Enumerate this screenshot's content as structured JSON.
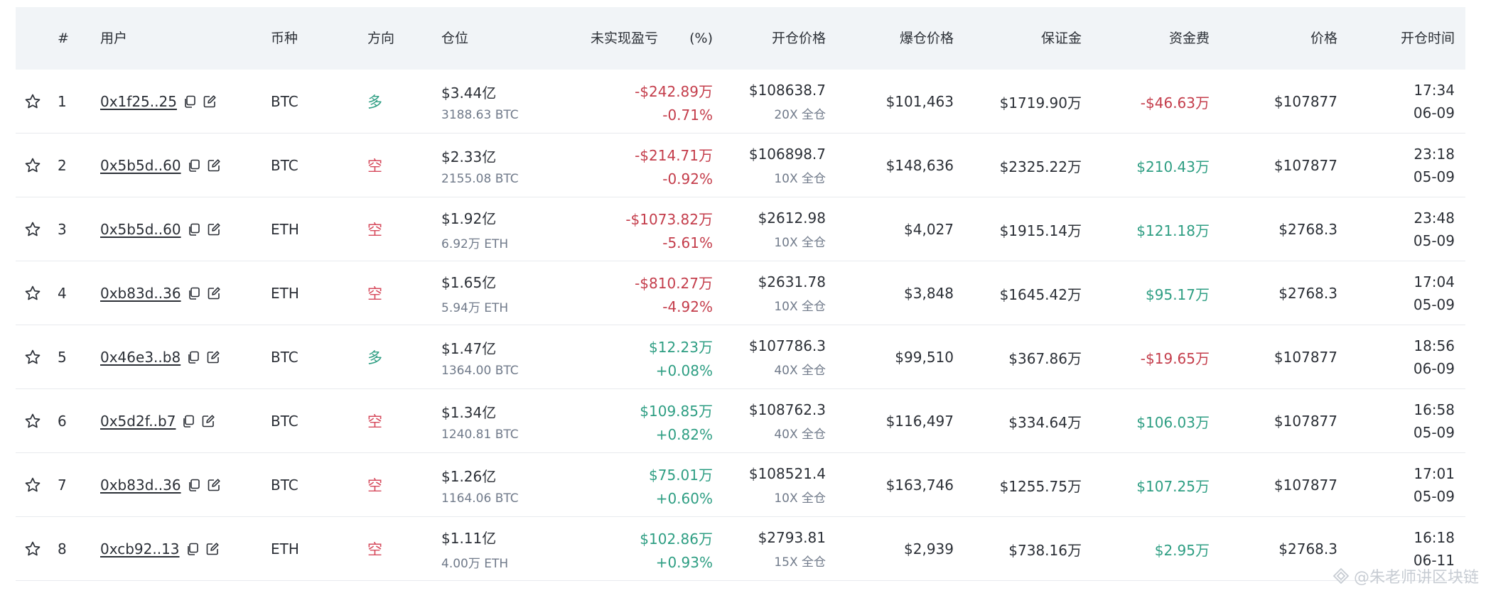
{
  "headers": {
    "idx": "#",
    "user": "用户",
    "coin": "币种",
    "direction": "方向",
    "position": "仓位",
    "pnl": "未实现盈亏",
    "pnl_pct": "(%)",
    "entry": "开仓价格",
    "liq": "爆仓价格",
    "margin": "保证金",
    "funding": "资金费",
    "price": "价格",
    "open_time": "开仓时间"
  },
  "rows": [
    {
      "idx": "1",
      "user": "0x1f25..25",
      "coin": "BTC",
      "direction": "多",
      "dir_type": "long",
      "pos_value": "$3.44亿",
      "pos_size": "3188.63 BTC",
      "pnl": "-$242.89万",
      "pnl_pct": "-0.71%",
      "pnl_sign": "neg",
      "entry": "$108638.7",
      "leverage": "20X 全仓",
      "liq": "$101,463",
      "margin": "$1719.90万",
      "funding": "-$46.63万",
      "fund_sign": "neg",
      "price": "$107877",
      "time": "17:34",
      "date": "06-09"
    },
    {
      "idx": "2",
      "user": "0x5b5d..60",
      "coin": "BTC",
      "direction": "空",
      "dir_type": "short",
      "pos_value": "$2.33亿",
      "pos_size": "2155.08 BTC",
      "pnl": "-$214.71万",
      "pnl_pct": "-0.92%",
      "pnl_sign": "neg",
      "entry": "$106898.7",
      "leverage": "10X 全仓",
      "liq": "$148,636",
      "margin": "$2325.22万",
      "funding": "$210.43万",
      "fund_sign": "pos",
      "price": "$107877",
      "time": "23:18",
      "date": "05-09"
    },
    {
      "idx": "3",
      "user": "0x5b5d..60",
      "coin": "ETH",
      "direction": "空",
      "dir_type": "short",
      "pos_value": "$1.92亿",
      "pos_size": "6.92万 ETH",
      "pnl": "-$1073.82万",
      "pnl_pct": "-5.61%",
      "pnl_sign": "neg",
      "entry": "$2612.98",
      "leverage": "10X 全仓",
      "liq": "$4,027",
      "margin": "$1915.14万",
      "funding": "$121.18万",
      "fund_sign": "pos",
      "price": "$2768.3",
      "time": "23:48",
      "date": "05-09"
    },
    {
      "idx": "4",
      "user": "0xb83d..36",
      "coin": "ETH",
      "direction": "空",
      "dir_type": "short",
      "pos_value": "$1.65亿",
      "pos_size": "5.94万 ETH",
      "pnl": "-$810.27万",
      "pnl_pct": "-4.92%",
      "pnl_sign": "neg",
      "entry": "$2631.78",
      "leverage": "10X 全仓",
      "liq": "$3,848",
      "margin": "$1645.42万",
      "funding": "$95.17万",
      "fund_sign": "pos",
      "price": "$2768.3",
      "time": "17:04",
      "date": "05-09"
    },
    {
      "idx": "5",
      "user": "0x46e3..b8",
      "coin": "BTC",
      "direction": "多",
      "dir_type": "long",
      "pos_value": "$1.47亿",
      "pos_size": "1364.00 BTC",
      "pnl": "$12.23万",
      "pnl_pct": "+0.08%",
      "pnl_sign": "pos",
      "entry": "$107786.3",
      "leverage": "40X 全仓",
      "liq": "$99,510",
      "margin": "$367.86万",
      "funding": "-$19.65万",
      "fund_sign": "neg",
      "price": "$107877",
      "time": "18:56",
      "date": "06-09"
    },
    {
      "idx": "6",
      "user": "0x5d2f..b7",
      "coin": "BTC",
      "direction": "空",
      "dir_type": "short",
      "pos_value": "$1.34亿",
      "pos_size": "1240.81 BTC",
      "pnl": "$109.85万",
      "pnl_pct": "+0.82%",
      "pnl_sign": "pos",
      "entry": "$108762.3",
      "leverage": "40X 全仓",
      "liq": "$116,497",
      "margin": "$334.64万",
      "funding": "$106.03万",
      "fund_sign": "pos",
      "price": "$107877",
      "time": "16:58",
      "date": "05-09"
    },
    {
      "idx": "7",
      "user": "0xb83d..36",
      "coin": "BTC",
      "direction": "空",
      "dir_type": "short",
      "pos_value": "$1.26亿",
      "pos_size": "1164.06 BTC",
      "pnl": "$75.01万",
      "pnl_pct": "+0.60%",
      "pnl_sign": "pos",
      "entry": "$108521.4",
      "leverage": "10X 全仓",
      "liq": "$163,746",
      "margin": "$1255.75万",
      "funding": "$107.25万",
      "fund_sign": "pos",
      "price": "$107877",
      "time": "17:01",
      "date": "05-09"
    },
    {
      "idx": "8",
      "user": "0xcb92..13",
      "coin": "ETH",
      "direction": "空",
      "dir_type": "short",
      "pos_value": "$1.11亿",
      "pos_size": "4.00万 ETH",
      "pnl": "$102.86万",
      "pnl_pct": "+0.93%",
      "pnl_sign": "pos",
      "entry": "$2793.81",
      "leverage": "15X 全仓",
      "liq": "$2,939",
      "margin": "$738.16万",
      "funding": "$2.95万",
      "fund_sign": "pos",
      "price": "$2768.3",
      "time": "16:18",
      "date": "06-11"
    }
  ],
  "icons": {
    "favorite": "star-icon",
    "copy": "copy-icon",
    "edit": "edit-icon"
  },
  "colors": {
    "negative": "#c43d4b",
    "positive": "#2e9e83",
    "short": "#d64a5c",
    "header_bg": "#f1f4f7"
  },
  "watermark": "@朱老师讲区块链"
}
